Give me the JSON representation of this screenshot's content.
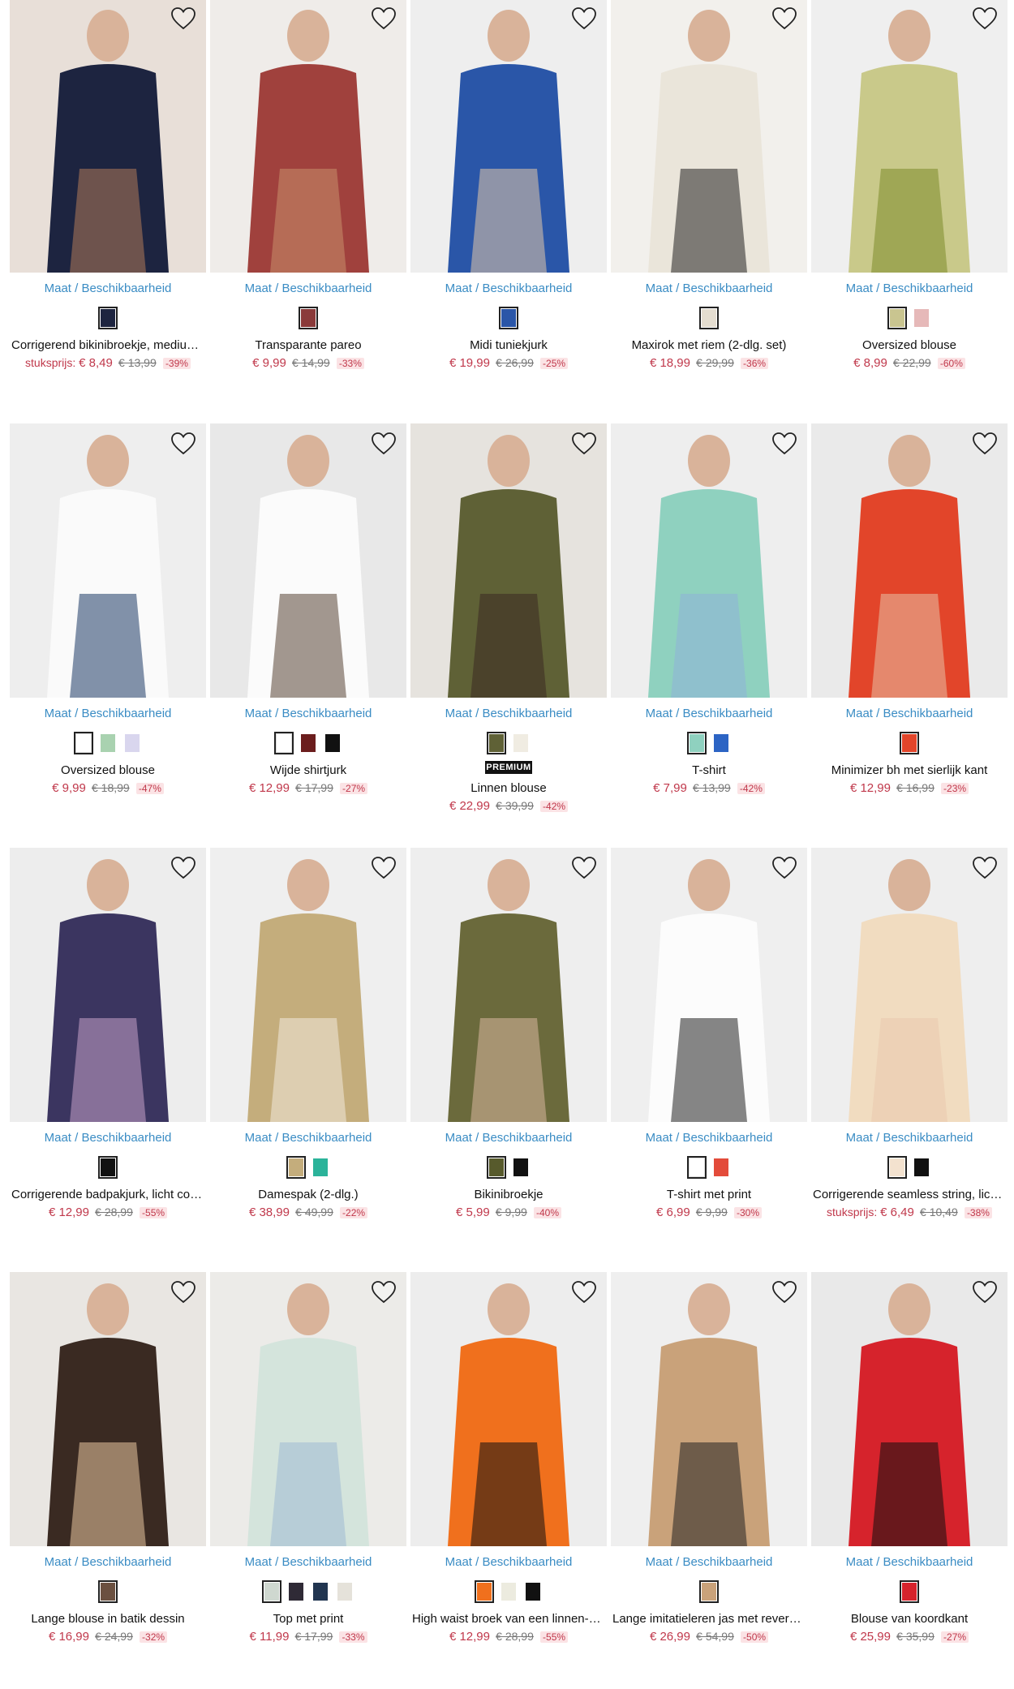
{
  "size_link_label": "Maat / Beschikbaarheid",
  "unit_price_label": "stuksprijs:",
  "premium_badge": "PREMIUM",
  "products": [
    {
      "name": "Corrigerend bikinibroekje, medium shape",
      "price": "€ 8,49",
      "old_price": "€ 13,99",
      "discount": "-39%",
      "unit_price": true,
      "swatches": [
        "#1d2440"
      ],
      "image_colors": [
        "#e8dfd8",
        "#1d2440",
        "#b07a58"
      ]
    },
    {
      "name": "Transparante pareo",
      "price": "€ 9,99",
      "old_price": "€ 14,99",
      "discount": "-33%",
      "swatches": [
        "#8a3a3a"
      ],
      "image_colors": [
        "#efece9",
        "#a0413d",
        "#c8906c"
      ]
    },
    {
      "name": "Midi tuniekjurk",
      "price": "€ 19,99",
      "old_price": "€ 26,99",
      "discount": "-25%",
      "swatches": [
        "#2a56a8"
      ],
      "image_colors": [
        "#eeeeee",
        "#2a56a8",
        "#e2c9a8"
      ]
    },
    {
      "name": "Maxirok met riem (2-dlg. set)",
      "price": "€ 18,99",
      "old_price": "€ 29,99",
      "discount": "-36%",
      "swatches": [
        "#e4ddd0"
      ],
      "image_colors": [
        "#f2f0ec",
        "#eae5da",
        "#222222"
      ]
    },
    {
      "name": "Oversized blouse",
      "price": "€ 8,99",
      "old_price": "€ 22,99",
      "discount": "-60%",
      "swatches": [
        "#c9c590",
        "#e6b9b9"
      ],
      "image_colors": [
        "#efefef",
        "#c9c98a",
        "#7b8a2a"
      ]
    },
    {
      "name": "Oversized blouse",
      "price": "€ 9,99",
      "old_price": "€ 18,99",
      "discount": "-47%",
      "swatches": [
        "#ffffff",
        "#a9d2b0",
        "#d9d6ee"
      ],
      "image_colors": [
        "#eeeeee",
        "#fafafa",
        "#1e3a66"
      ]
    },
    {
      "name": "Wijde shirtjurk",
      "price": "€ 12,99",
      "old_price": "€ 17,99",
      "discount": "-27%",
      "swatches": [
        "#ffffff",
        "#6b1d1d",
        "#111111"
      ],
      "image_colors": [
        "#e8e8e8",
        "#fbfbfb",
        "#5a4636"
      ]
    },
    {
      "name": "Linnen blouse",
      "price": "€ 22,99",
      "old_price": "€ 39,99",
      "discount": "-42%",
      "premium": true,
      "swatches": [
        "#5f6136",
        "#f0ece2"
      ],
      "image_colors": [
        "#e6e3de",
        "#5f6136",
        "#3a2a22"
      ]
    },
    {
      "name": "T-shirt",
      "price": "€ 7,99",
      "old_price": "€ 13,99",
      "discount": "-42%",
      "swatches": [
        "#8fd1bf",
        "#2c64c4"
      ],
      "image_colors": [
        "#eeeeee",
        "#8fd1bf",
        "#8fb3d9"
      ]
    },
    {
      "name": "Minimizer bh met sierlijk kant",
      "price": "€ 12,99",
      "old_price": "€ 16,99",
      "discount": "-23%",
      "swatches": [
        "#e2452a"
      ],
      "image_colors": [
        "#eaeaea",
        "#e2452a",
        "#e8c0a4"
      ]
    },
    {
      "name": "Corrigerende badpakjurk, licht corrigerend",
      "price": "€ 12,99",
      "old_price": "€ 28,99",
      "discount": "-55%",
      "swatches": [
        "#111111"
      ],
      "image_colors": [
        "#ededed",
        "#3b3560",
        "#c7a0c9"
      ]
    },
    {
      "name": "Damespak (2-dlg.)",
      "price": "€ 38,99",
      "old_price": "€ 49,99",
      "discount": "-22%",
      "swatches": [
        "#c4ad7c",
        "#2bb39a"
      ],
      "image_colors": [
        "#efefef",
        "#c4ad7c",
        "#f2e9dc"
      ]
    },
    {
      "name": "Bikinibroekje",
      "price": "€ 5,99",
      "old_price": "€ 9,99",
      "discount": "-40%",
      "swatches": [
        "#575a2c",
        "#111111"
      ],
      "image_colors": [
        "#eeeeee",
        "#6b6a3c",
        "#d9b79e"
      ]
    },
    {
      "name": "T-shirt met print",
      "price": "€ 6,99",
      "old_price": "€ 9,99",
      "discount": "-30%",
      "swatches": [
        "#ffffff",
        "#e34b3a"
      ],
      "image_colors": [
        "#efefef",
        "#fcfcfc",
        "#222222"
      ]
    },
    {
      "name": "Corrigerende seamless string, licht corrigerend",
      "price": "€ 6,49",
      "old_price": "€ 10,49",
      "discount": "-38%",
      "unit_price": true,
      "swatches": [
        "#f3e2cf",
        "#111111"
      ],
      "image_colors": [
        "#eeeeee",
        "#f1dcc0",
        "#e9c9ad"
      ]
    },
    {
      "name": "Lange blouse in batik dessin",
      "price": "€ 16,99",
      "old_price": "€ 24,99",
      "discount": "-32%",
      "swatches": [
        "#6b5040"
      ],
      "image_colors": [
        "#e9e6e2",
        "#3a2a22",
        "#e9c6a0"
      ]
    },
    {
      "name": "Top met print",
      "price": "€ 11,99",
      "old_price": "€ 17,99",
      "discount": "-33%",
      "swatches": [
        "#cfd8d0",
        "#2f2a36",
        "#213550",
        "#e5e2da"
      ],
      "image_colors": [
        "#ecebe8",
        "#d4e4dc",
        "#9fb9d4"
      ]
    },
    {
      "name": "High waist broek van een linnen-viscose mix",
      "price": "€ 12,99",
      "old_price": "€ 28,99",
      "discount": "-55%",
      "swatches": [
        "#f0701d",
        "#ecebdf",
        "#111111"
      ],
      "image_colors": [
        "#ededed",
        "#f0701d",
        "#111111"
      ]
    },
    {
      "name": "Lange imitatieleren jas met revers, getailleerd",
      "price": "€ 26,99",
      "old_price": "€ 54,99",
      "discount": "-50%",
      "swatches": [
        "#c9a27a"
      ],
      "image_colors": [
        "#efefef",
        "#c9a27a",
        "#222222"
      ]
    },
    {
      "name": "Blouse van koordkant",
      "price": "€ 25,99",
      "old_price": "€ 35,99",
      "discount": "-27%",
      "swatches": [
        "#d6232c"
      ],
      "image_colors": [
        "#e9e9e9",
        "#d6232c",
        "#111111"
      ]
    }
  ]
}
